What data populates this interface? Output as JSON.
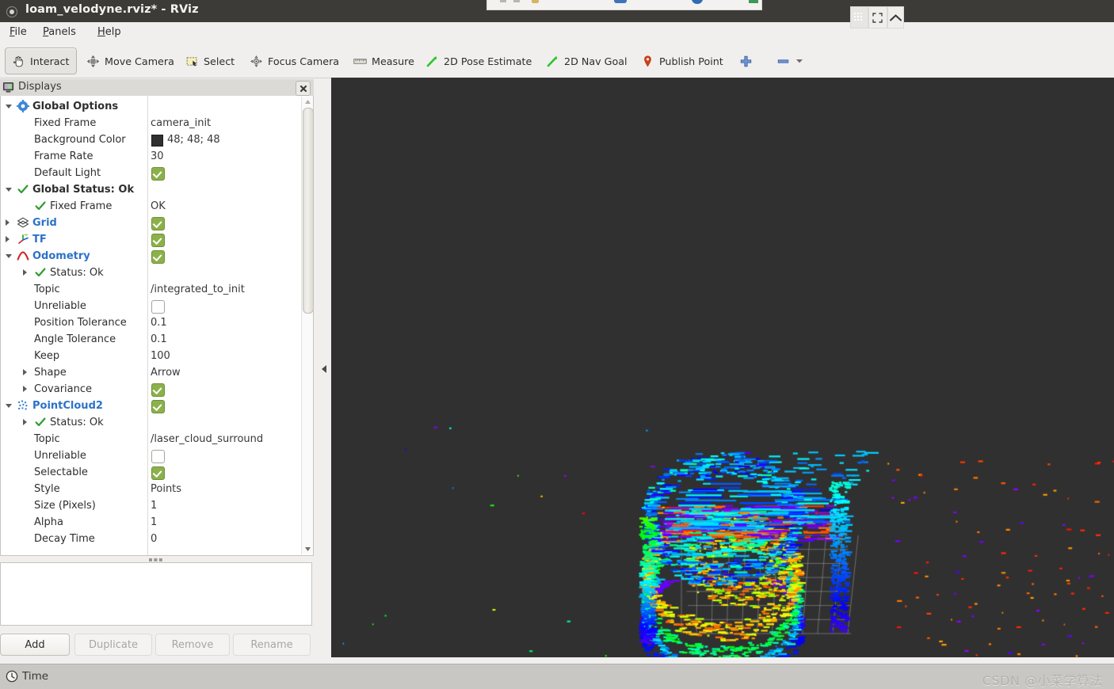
{
  "window": {
    "title": "loam_velodyne.rviz* - RViz",
    "dot_icon": "window-menu-icon"
  },
  "menubar": {
    "items": [
      {
        "label": "File",
        "mnemonic": "F"
      },
      {
        "label": "Panels",
        "mnemonic": "P"
      },
      {
        "label": "Help",
        "mnemonic": "H"
      }
    ]
  },
  "toolbar": {
    "items": [
      {
        "label": "Interact",
        "icon": "hand-cursor-icon",
        "active": true
      },
      {
        "label": "Move Camera",
        "icon": "move-camera-icon",
        "active": false
      },
      {
        "label": "Select",
        "icon": "select-rect-icon",
        "active": false
      },
      {
        "label": "Focus Camera",
        "icon": "focus-camera-icon",
        "active": false
      },
      {
        "label": "Measure",
        "icon": "ruler-icon",
        "active": false
      },
      {
        "label": "2D Pose Estimate",
        "icon": "pose-arrow-icon",
        "active": false
      },
      {
        "label": "2D Nav Goal",
        "icon": "nav-goal-arrow-icon",
        "active": false
      },
      {
        "label": "Publish Point",
        "icon": "map-pin-icon",
        "active": false
      }
    ],
    "add_tool_icon": "plus-icon",
    "remove_tool_icon": "minus-icon",
    "overflow_icon": "chevron-down-icon"
  },
  "displays": {
    "panel_title": "Displays",
    "panel_icon": "displays-monitor-icon",
    "close_icon": "close-icon",
    "rows": [
      {
        "indent": 0,
        "twisty": "open",
        "icon": "gear-icon",
        "label": "Global Options",
        "style": "plain-bold",
        "value_type": "none"
      },
      {
        "indent": 1,
        "twisty": "none",
        "icon": "none",
        "label": "Fixed Frame",
        "style": "plain",
        "value_type": "text",
        "value": "camera_init"
      },
      {
        "indent": 1,
        "twisty": "none",
        "icon": "none",
        "label": "Background Color",
        "style": "plain",
        "value_type": "color",
        "value": "48; 48; 48",
        "color": "#303030"
      },
      {
        "indent": 1,
        "twisty": "none",
        "icon": "none",
        "label": "Frame Rate",
        "style": "plain",
        "value_type": "text",
        "value": "30"
      },
      {
        "indent": 1,
        "twisty": "none",
        "icon": "none",
        "label": "Default Light",
        "style": "plain",
        "value_type": "checkbox",
        "checked": true
      },
      {
        "indent": 0,
        "twisty": "open",
        "icon": "check-icon",
        "label": "Global Status: Ok",
        "style": "plain-bold",
        "value_type": "none"
      },
      {
        "indent": 1,
        "twisty": "none",
        "icon": "check-icon",
        "label": "Fixed Frame",
        "style": "plain",
        "value_type": "text",
        "value": "OK"
      },
      {
        "indent": 0,
        "twisty": "closed",
        "icon": "grid-icon",
        "label": "Grid",
        "style": "blue",
        "value_type": "checkbox",
        "checked": true
      },
      {
        "indent": 0,
        "twisty": "closed",
        "icon": "tf-axes-icon",
        "label": "TF",
        "style": "blue",
        "value_type": "checkbox",
        "checked": true
      },
      {
        "indent": 0,
        "twisty": "open",
        "icon": "odometry-icon",
        "label": "Odometry",
        "style": "blue",
        "value_type": "checkbox",
        "checked": true
      },
      {
        "indent": 1,
        "twisty": "closed",
        "icon": "check-icon",
        "label": "Status: Ok",
        "style": "plain",
        "value_type": "none"
      },
      {
        "indent": 1,
        "twisty": "none",
        "icon": "none",
        "label": "Topic",
        "style": "plain",
        "value_type": "text",
        "value": "/integrated_to_init"
      },
      {
        "indent": 1,
        "twisty": "none",
        "icon": "none",
        "label": "Unreliable",
        "style": "plain",
        "value_type": "checkbox",
        "checked": false
      },
      {
        "indent": 1,
        "twisty": "none",
        "icon": "none",
        "label": "Position Tolerance",
        "style": "plain",
        "value_type": "text",
        "value": "0.1"
      },
      {
        "indent": 1,
        "twisty": "none",
        "icon": "none",
        "label": "Angle Tolerance",
        "style": "plain",
        "value_type": "text",
        "value": "0.1"
      },
      {
        "indent": 1,
        "twisty": "none",
        "icon": "none",
        "label": "Keep",
        "style": "plain",
        "value_type": "text",
        "value": "100"
      },
      {
        "indent": 1,
        "twisty": "closed",
        "icon": "none",
        "label": "Shape",
        "style": "plain",
        "value_type": "text",
        "value": "Arrow"
      },
      {
        "indent": 1,
        "twisty": "closed",
        "icon": "none",
        "label": "Covariance",
        "style": "plain",
        "value_type": "checkbox",
        "checked": true
      },
      {
        "indent": 0,
        "twisty": "open",
        "icon": "pointcloud-icon",
        "label": "PointCloud2",
        "style": "blue",
        "value_type": "checkbox",
        "checked": true
      },
      {
        "indent": 1,
        "twisty": "closed",
        "icon": "check-icon",
        "label": "Status: Ok",
        "style": "plain",
        "value_type": "none"
      },
      {
        "indent": 1,
        "twisty": "none",
        "icon": "none",
        "label": "Topic",
        "style": "plain",
        "value_type": "text",
        "value": "/laser_cloud_surround"
      },
      {
        "indent": 1,
        "twisty": "none",
        "icon": "none",
        "label": "Unreliable",
        "style": "plain",
        "value_type": "checkbox",
        "checked": false
      },
      {
        "indent": 1,
        "twisty": "none",
        "icon": "none",
        "label": "Selectable",
        "style": "plain",
        "value_type": "checkbox",
        "checked": true
      },
      {
        "indent": 1,
        "twisty": "none",
        "icon": "none",
        "label": "Style",
        "style": "plain",
        "value_type": "text",
        "value": "Points"
      },
      {
        "indent": 1,
        "twisty": "none",
        "icon": "none",
        "label": "Size (Pixels)",
        "style": "plain",
        "value_type": "text",
        "value": "1"
      },
      {
        "indent": 1,
        "twisty": "none",
        "icon": "none",
        "label": "Alpha",
        "style": "plain",
        "value_type": "text",
        "value": "1"
      },
      {
        "indent": 1,
        "twisty": "none",
        "icon": "none",
        "label": "Decay Time",
        "style": "plain",
        "value_type": "text",
        "value": "0"
      }
    ],
    "buttons": [
      {
        "label": "Add",
        "enabled": true
      },
      {
        "label": "Duplicate",
        "enabled": false
      },
      {
        "label": "Remove",
        "enabled": false
      },
      {
        "label": "Rename",
        "enabled": false
      }
    ],
    "description": ""
  },
  "view3d": {
    "background_color": "#303030",
    "collapse_icon": "collapse-left-icon"
  },
  "statusbar": {
    "time_label": "Time",
    "clock_icon": "clock-icon",
    "watermark": "CSDN @小菜学算法"
  },
  "overlay": {
    "grid_icon": "grid-view-icon",
    "expand_icon": "fullscreen-icon",
    "collapse_icon": "chevron-up-icon"
  }
}
